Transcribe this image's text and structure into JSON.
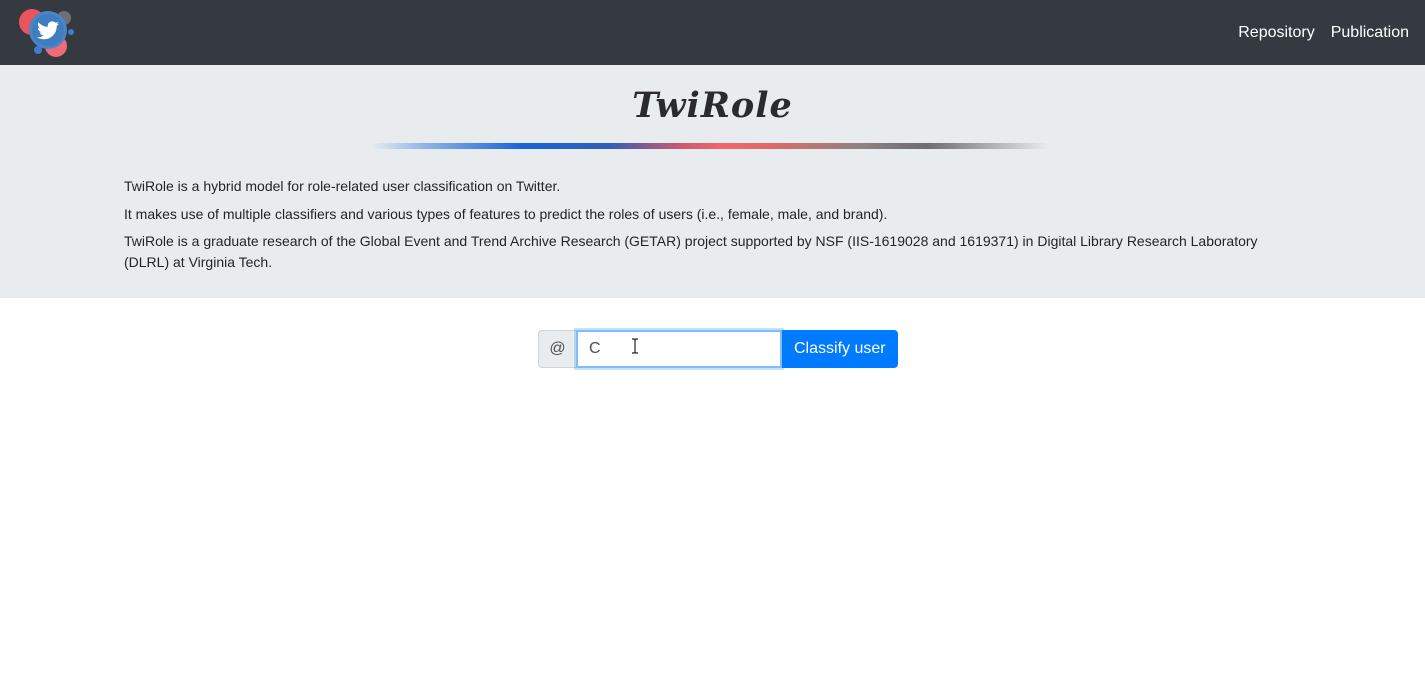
{
  "nav": {
    "links": [
      {
        "label": "Repository"
      },
      {
        "label": "Publication"
      }
    ],
    "logo_icon": "twitter-bird-icon"
  },
  "hero": {
    "title": "TwiRole",
    "paragraphs": [
      "TwiRole is a hybrid model for role-related user classification on Twitter.",
      "It makes use of multiple classifiers and various types of features to predict the roles of users (i.e., female, male, and brand).",
      "TwiRole is a graduate research of the Global Event and Trend Archive Research (GETAR) project supported by NSF (IIS-1619028 and 1619371) in Digital Library Research Laboratory (DLRL) at Virginia Tech."
    ]
  },
  "search": {
    "prefix": "@",
    "value": "C",
    "button_label": "Classify user"
  },
  "colors": {
    "navbar": "#343a40",
    "hero": "#e9ecef",
    "primary": "#007bff",
    "focus": "#80bdff"
  }
}
